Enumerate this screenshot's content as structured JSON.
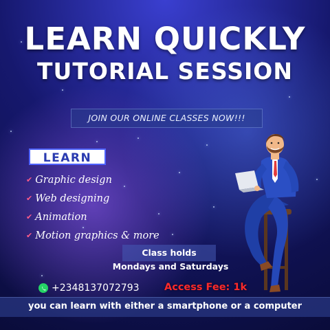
{
  "poster": {
    "title_line1": "LEARN QUICKLY",
    "title_line2": "TUTORIAL SESSION",
    "join_banner": "JOIN OUR ONLINE CLASSES NOW!!!",
    "learn_label": "LEARN",
    "courses": [
      "Graphic design",
      "Web designing",
      "Animation",
      "Motion graphics & more"
    ],
    "bullet_icon": "check-icon",
    "class_holds": "Class holds",
    "class_days": "Mondays and Saturdays",
    "phone": "+2348137072793",
    "contact_icon": "whatsapp-icon",
    "access_fee": "Access Fee:  1k",
    "bottom_note": "you can learn with either a smartphone or a computer",
    "colors": {
      "background": "#16186e",
      "accent_pink": "#ff5c8a",
      "fee_red": "#ff2a2a",
      "whatsapp_green": "#25d366",
      "learn_badge_text": "#2a3bb0"
    }
  }
}
